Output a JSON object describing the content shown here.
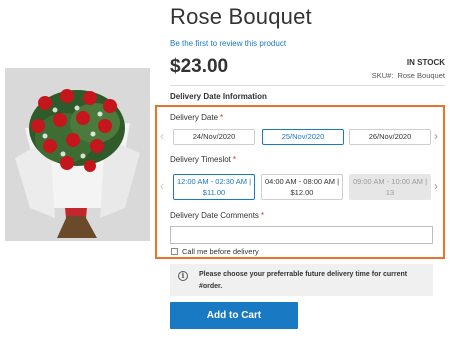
{
  "product": {
    "title": "Rose Bouquet",
    "review_link": "Be the first to review this product",
    "price": "$23.00",
    "stock_status": "IN STOCK",
    "sku_label": "SKU#:",
    "sku_value": "Rose Bouquet"
  },
  "delivery": {
    "section_title": "Delivery Date Information",
    "date_label": "Delivery Date",
    "required_mark": "*",
    "dates": [
      "24/Nov/2020",
      "25/Nov/2020",
      "26/Nov/2020"
    ],
    "selected_date_index": 1,
    "timeslot_label": "Delivery Timeslot",
    "timeslots": [
      {
        "time": "12:00 AM - 02:30 AM |",
        "price": "$11.00",
        "state": "selected"
      },
      {
        "time": "04:00 AM - 08:00 AM |",
        "price": "$12.00",
        "state": "available"
      },
      {
        "time": "09:00 AM - 10:00 AM |",
        "price": "13",
        "state": "disabled"
      }
    ],
    "comments_label": "Delivery Date Comments",
    "comments_value": "",
    "call_me_label": "Call me before delivery",
    "call_me_checked": false
  },
  "notice": {
    "text": "Please choose your preferrable future delivery time for current #order."
  },
  "cart": {
    "button_label": "Add to Cart"
  },
  "icons": {
    "prev": "chevron-left-icon",
    "next": "chevron-right-icon",
    "info": "info-icon"
  },
  "colors": {
    "accent": "#1979c3",
    "highlight": "#e8732f",
    "required": "#e02b27"
  }
}
